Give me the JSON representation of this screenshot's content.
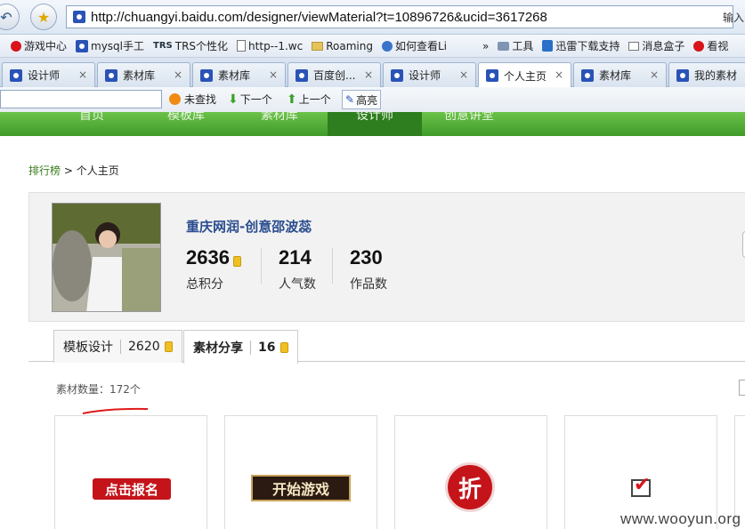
{
  "browser": {
    "url": "http://chuangyi.baidu.com/designer/viewMaterial?t=10896726&ucid=3617268",
    "go_label": "输入",
    "favorites": [
      {
        "label": "游戏中心",
        "icon": "red-circle-icon"
      },
      {
        "label": "mysql手工",
        "icon": "paw-icon"
      },
      {
        "label": "TRS个性化",
        "icon": "trs-icon"
      },
      {
        "label": "http--1.wc",
        "icon": "doc-icon"
      },
      {
        "label": "Roaming",
        "icon": "folder-icon"
      },
      {
        "label": "如何查看Li",
        "icon": "globe-icon"
      },
      {
        "label": "工具",
        "icon": "tools-icon"
      },
      {
        "label": "迅雷下载支持",
        "icon": "xunlei-icon"
      },
      {
        "label": "消息盒子",
        "icon": "message-icon"
      },
      {
        "label": "看视",
        "icon": "video-icon"
      }
    ],
    "favorites_more": "»",
    "tabs": [
      {
        "label": "设计师"
      },
      {
        "label": "素材库"
      },
      {
        "label": "素材库"
      },
      {
        "label": "百度创..."
      },
      {
        "label": "设计师"
      },
      {
        "label": "个人主页"
      },
      {
        "label": "素材库"
      },
      {
        "label": "我的素材"
      }
    ],
    "active_tab": 5,
    "find": {
      "status": "未查找",
      "next": "下一个",
      "prev": "上一个",
      "highlight": "高亮"
    }
  },
  "site_nav": [
    "首页",
    "模板库",
    "素材库",
    "设计师",
    "创意讲堂"
  ],
  "breadcrumb": {
    "link": "排行榜",
    "separator": ">",
    "current": "个人主页"
  },
  "profile": {
    "name": "重庆网润-创意邵波蕊",
    "stats": [
      {
        "value": "2636",
        "label": "总积分"
      },
      {
        "value": "214",
        "label": "人气数"
      },
      {
        "value": "230",
        "label": "作品数"
      }
    ]
  },
  "profile_tabs": [
    {
      "label": "模板设计",
      "count": "2620"
    },
    {
      "label": "素材分享",
      "count": "16"
    }
  ],
  "material_count_label": "素材数量：",
  "material_count": "172个",
  "cards": [
    {
      "text": "点击报名"
    },
    {
      "text": "开始游戏"
    },
    {
      "text": "折"
    },
    {
      "text": ""
    }
  ],
  "watermark": "www.wooyun.org",
  "colors": {
    "brand_green": "#4ba534",
    "accent_red": "#c4141a",
    "name_blue": "#2a4d8f"
  }
}
